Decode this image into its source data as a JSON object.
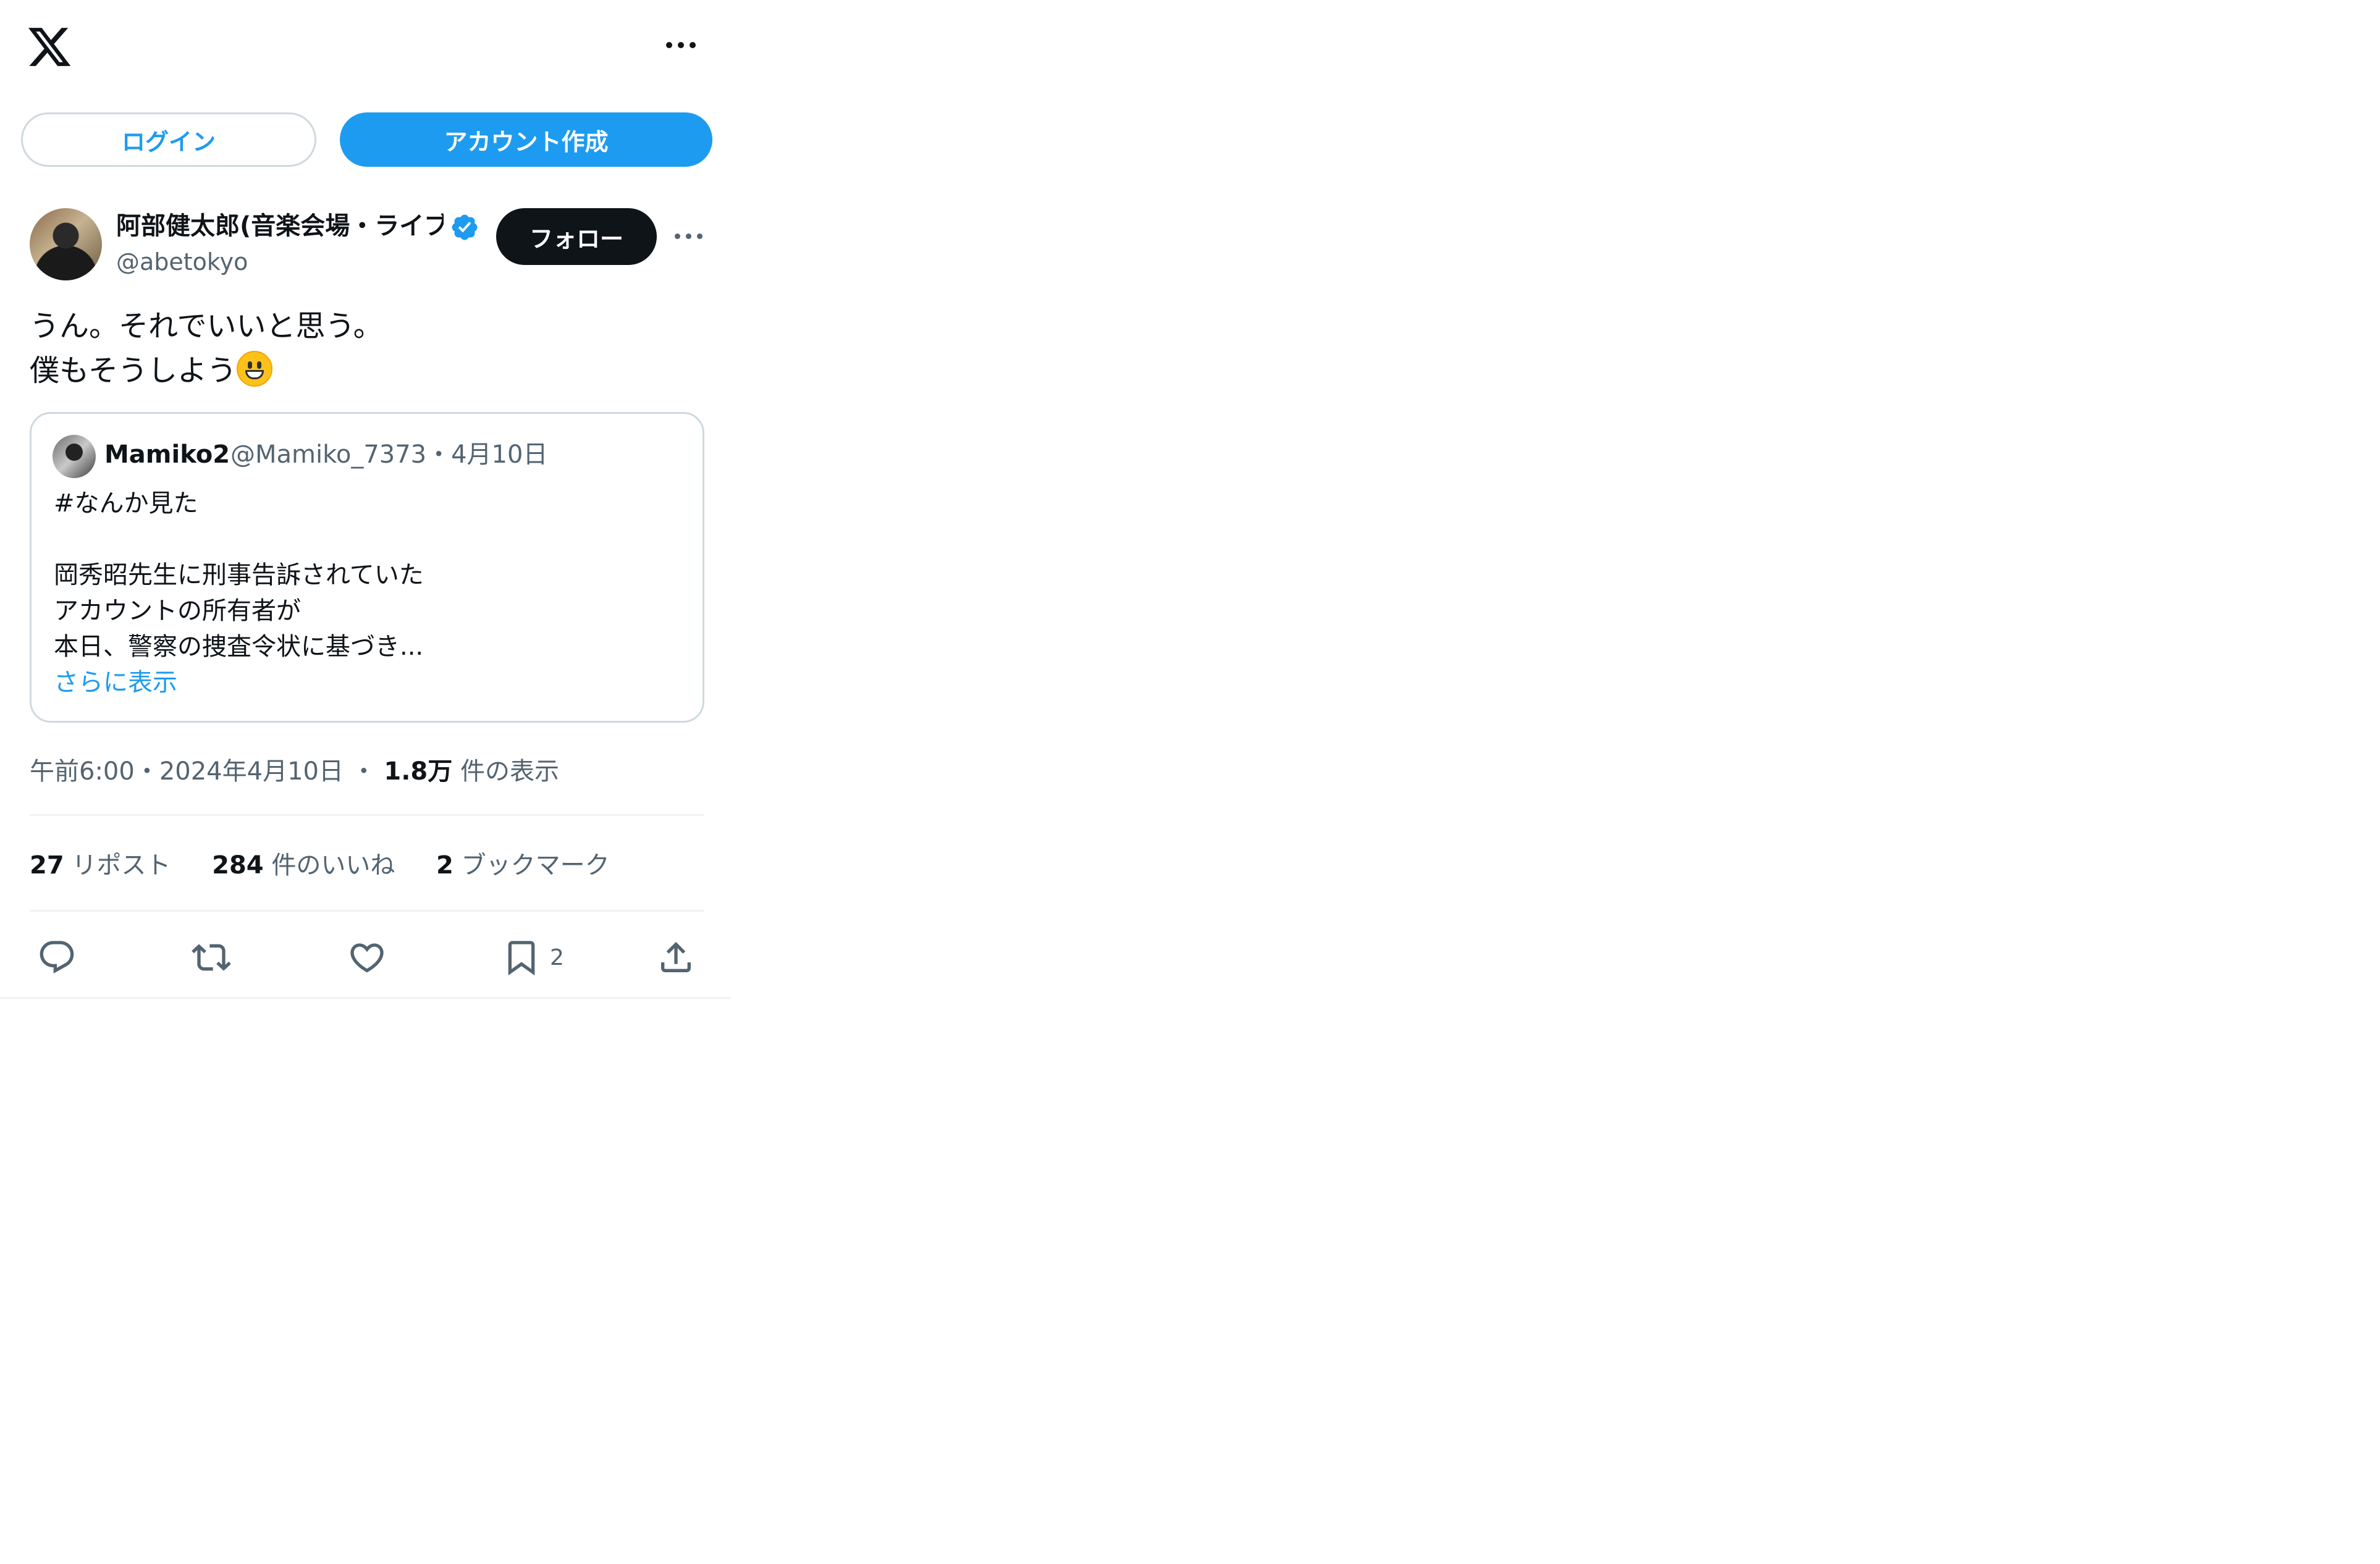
{
  "header": {
    "logo": "x-logo-icon",
    "more": "more-horizontal-icon"
  },
  "auth": {
    "login_label": "ログイン",
    "signup_label": "アカウント作成"
  },
  "post": {
    "display_name": "阿部健太郎(音楽会場・ライブハウス・コンサートホール経営者)",
    "handle": "@abetokyo",
    "verified_icon": "verified-badge-icon",
    "follow_label": "フォロー",
    "text_lines": [
      "うん。それでいいと思う。",
      "僕もそうしよう"
    ],
    "emoji": "grinning-face-emoji",
    "timestamp": "午前6:00・2024年4月10日",
    "views_count": "1.8万",
    "views_label": "件の表示"
  },
  "quote": {
    "name": "Mamiko2",
    "meta": "@Mamiko_7373・4月10日",
    "lines": [
      "#なんか見た",
      "",
      "岡秀昭先生に刑事告訴されていた",
      "アカウントの所有者が",
      "本日、警察の捜査令状に基づき..."
    ],
    "show_more": "さらに表示"
  },
  "stats": {
    "reposts_count": "27",
    "reposts_label": "リポスト",
    "likes_count": "284",
    "likes_label": "件のいいね",
    "bookmarks_count": "2",
    "bookmarks_label": "ブックマーク"
  },
  "actions": {
    "reply_icon": "reply-icon",
    "repost_icon": "repost-icon",
    "like_icon": "like-icon",
    "bookmark_icon": "bookmark-icon",
    "bookmark_count": "2",
    "share_icon": "share-icon"
  },
  "colors": {
    "accent": "#1d9bf0",
    "text": "#0f1419",
    "muted": "#536471",
    "border": "#cfd9de"
  }
}
